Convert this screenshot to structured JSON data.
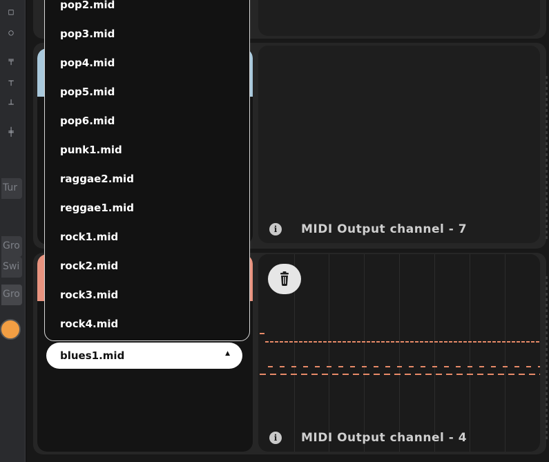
{
  "sidebar": {
    "buttons": [
      {
        "label": "Tur"
      },
      {
        "label": "Gro"
      },
      {
        "label": "Swi"
      },
      {
        "label": "Gro"
      }
    ]
  },
  "dropdown": {
    "items": [
      {
        "label": "pop2.mid"
      },
      {
        "label": "pop3.mid"
      },
      {
        "label": "pop4.mid"
      },
      {
        "label": "pop5.mid"
      },
      {
        "label": "pop6.mid"
      },
      {
        "label": "punk1.mid"
      },
      {
        "label": "raggae2.mid"
      },
      {
        "label": "reggae1.mid"
      },
      {
        "label": "rock1.mid"
      },
      {
        "label": "rock2.mid"
      },
      {
        "label": "rock3.mid"
      },
      {
        "label": "rock4.mid"
      }
    ],
    "selected": "blues1.mid"
  },
  "channels": [
    {
      "label": "MIDI Output channel - 7"
    },
    {
      "label": "MIDI Output channel - 4"
    }
  ],
  "colors": {
    "tab_blue": "#a9c9dc",
    "tab_salmon": "#e8937f",
    "note": "#e88a68",
    "sidebar_accent": "#f29e43"
  },
  "icons": {
    "info": "info-icon",
    "trash": "trash-icon",
    "caret": "caret-up-icon"
  }
}
